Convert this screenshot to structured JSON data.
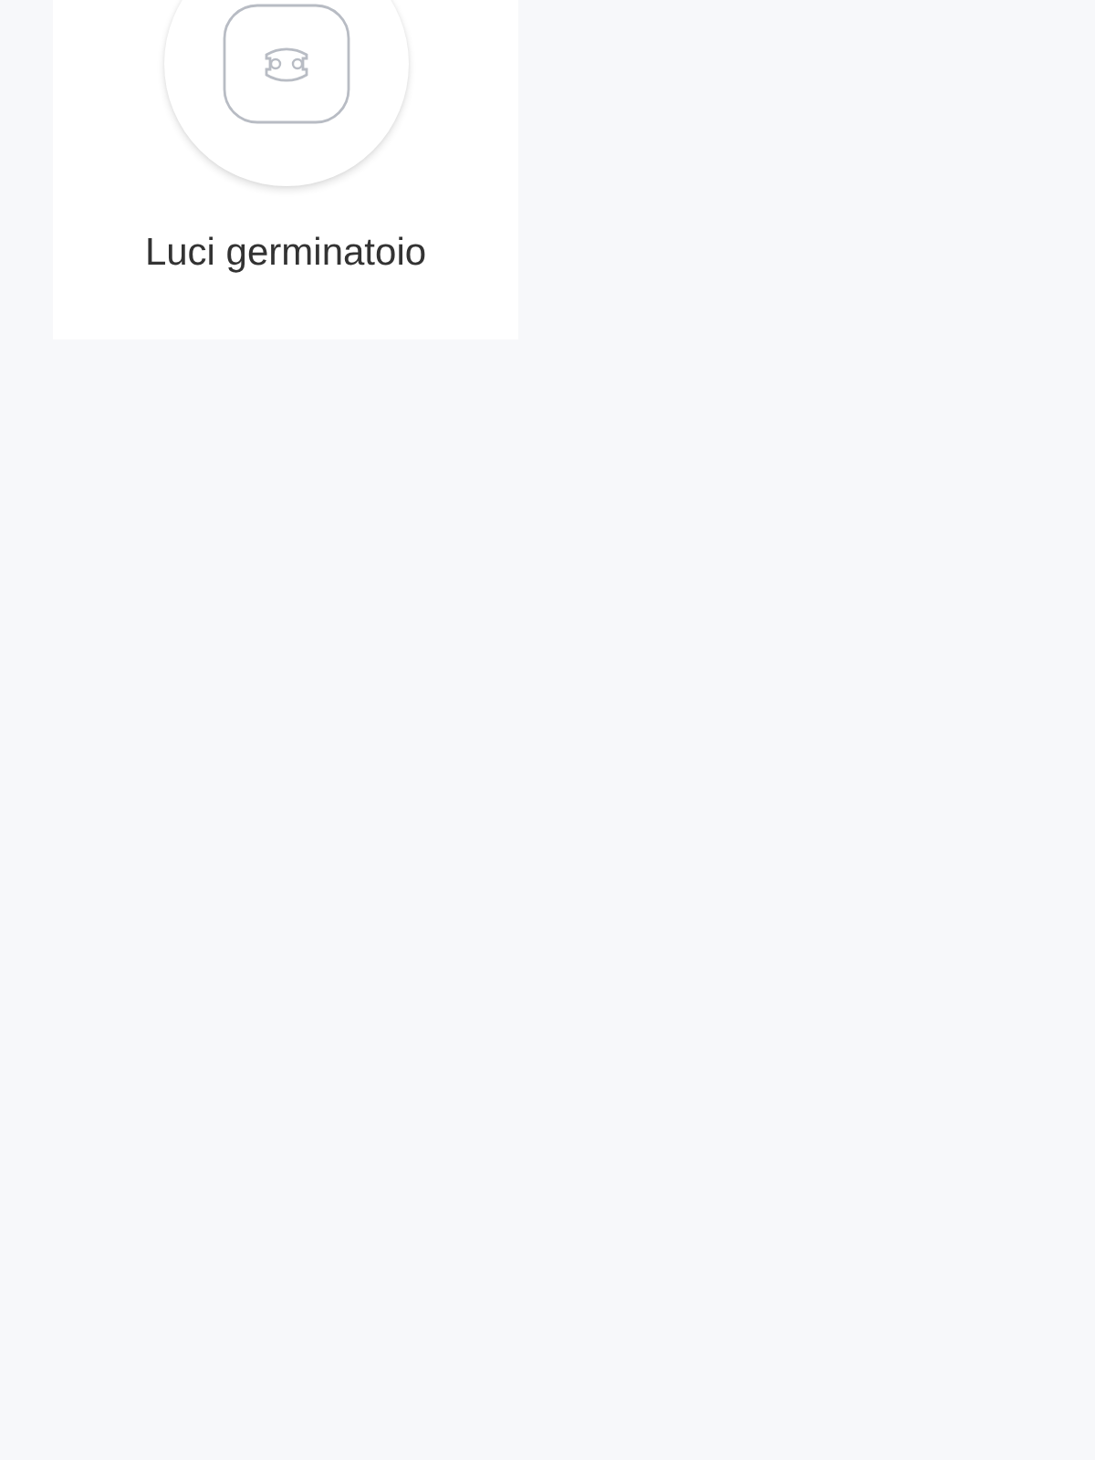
{
  "devices": [
    {
      "name": "Luci germinatoio",
      "kind": "socket"
    }
  ]
}
